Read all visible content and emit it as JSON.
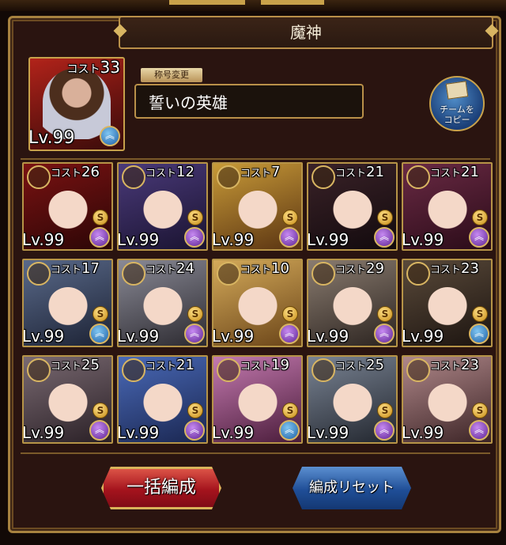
{
  "panel_title": "魔神",
  "leader": {
    "cost_label": "コスト",
    "cost": "33",
    "level": "Lv.99",
    "skill_badge": "blue"
  },
  "title_change_label": "称号変更",
  "title_value": "誓いの英雄",
  "copy_button": {
    "label_line1": "チームを",
    "label_line2": "コピー"
  },
  "units": [
    {
      "cost": "26",
      "level": "Lv.99",
      "badge": "purple",
      "colors": [
        "#7a1212",
        "#2b0606"
      ]
    },
    {
      "cost": "12",
      "level": "Lv.99",
      "badge": "purple",
      "colors": [
        "#4a3a7a",
        "#1a1330"
      ]
    },
    {
      "cost": "7",
      "level": "Lv.99",
      "badge": "purple",
      "colors": [
        "#c89a38",
        "#5a3412"
      ]
    },
    {
      "cost": "21",
      "level": "Lv.99",
      "badge": "purple",
      "colors": [
        "#3a2228",
        "#120a0d"
      ]
    },
    {
      "cost": "21",
      "level": "Lv.99",
      "badge": "purple",
      "colors": [
        "#6a2a44",
        "#2a0b18"
      ]
    },
    {
      "cost": "17",
      "level": "Lv.99",
      "badge": "blue",
      "colors": [
        "#5a6a8a",
        "#1c2234"
      ]
    },
    {
      "cost": "24",
      "level": "Lv.99",
      "badge": "purple",
      "colors": [
        "#8a8a96",
        "#2c2a30"
      ]
    },
    {
      "cost": "10",
      "level": "Lv.99",
      "badge": "purple",
      "colors": [
        "#d4aa5a",
        "#6a4418"
      ]
    },
    {
      "cost": "29",
      "level": "Lv.99",
      "badge": "purple",
      "colors": [
        "#8a7c70",
        "#2c2420"
      ]
    },
    {
      "cost": "23",
      "level": "Lv.99",
      "badge": "blue",
      "colors": [
        "#5a4a3a",
        "#1c1410"
      ]
    },
    {
      "cost": "25",
      "level": "Lv.99",
      "badge": "purple",
      "colors": [
        "#7a6a72",
        "#2a2026"
      ]
    },
    {
      "cost": "21",
      "level": "Lv.99",
      "badge": "purple",
      "colors": [
        "#4a6ab8",
        "#1a2650"
      ]
    },
    {
      "cost": "19",
      "level": "Lv.99",
      "badge": "blue",
      "colors": [
        "#c47ab0",
        "#4a1c3a"
      ]
    },
    {
      "cost": "25",
      "level": "Lv.99",
      "badge": "purple",
      "colors": [
        "#7a8494",
        "#22262e"
      ]
    },
    {
      "cost": "23",
      "level": "Lv.99",
      "badge": "purple",
      "colors": [
        "#b0888a",
        "#3c2426"
      ]
    }
  ],
  "unit_cost_label": "コスト",
  "buttons": {
    "bulk_form": "一括編成",
    "reset": "編成リセット"
  },
  "colors": {
    "gold": "#b99049",
    "panel_bg": "#2a1410",
    "red_button": "#a4131d",
    "blue_button": "#1f4e97"
  }
}
